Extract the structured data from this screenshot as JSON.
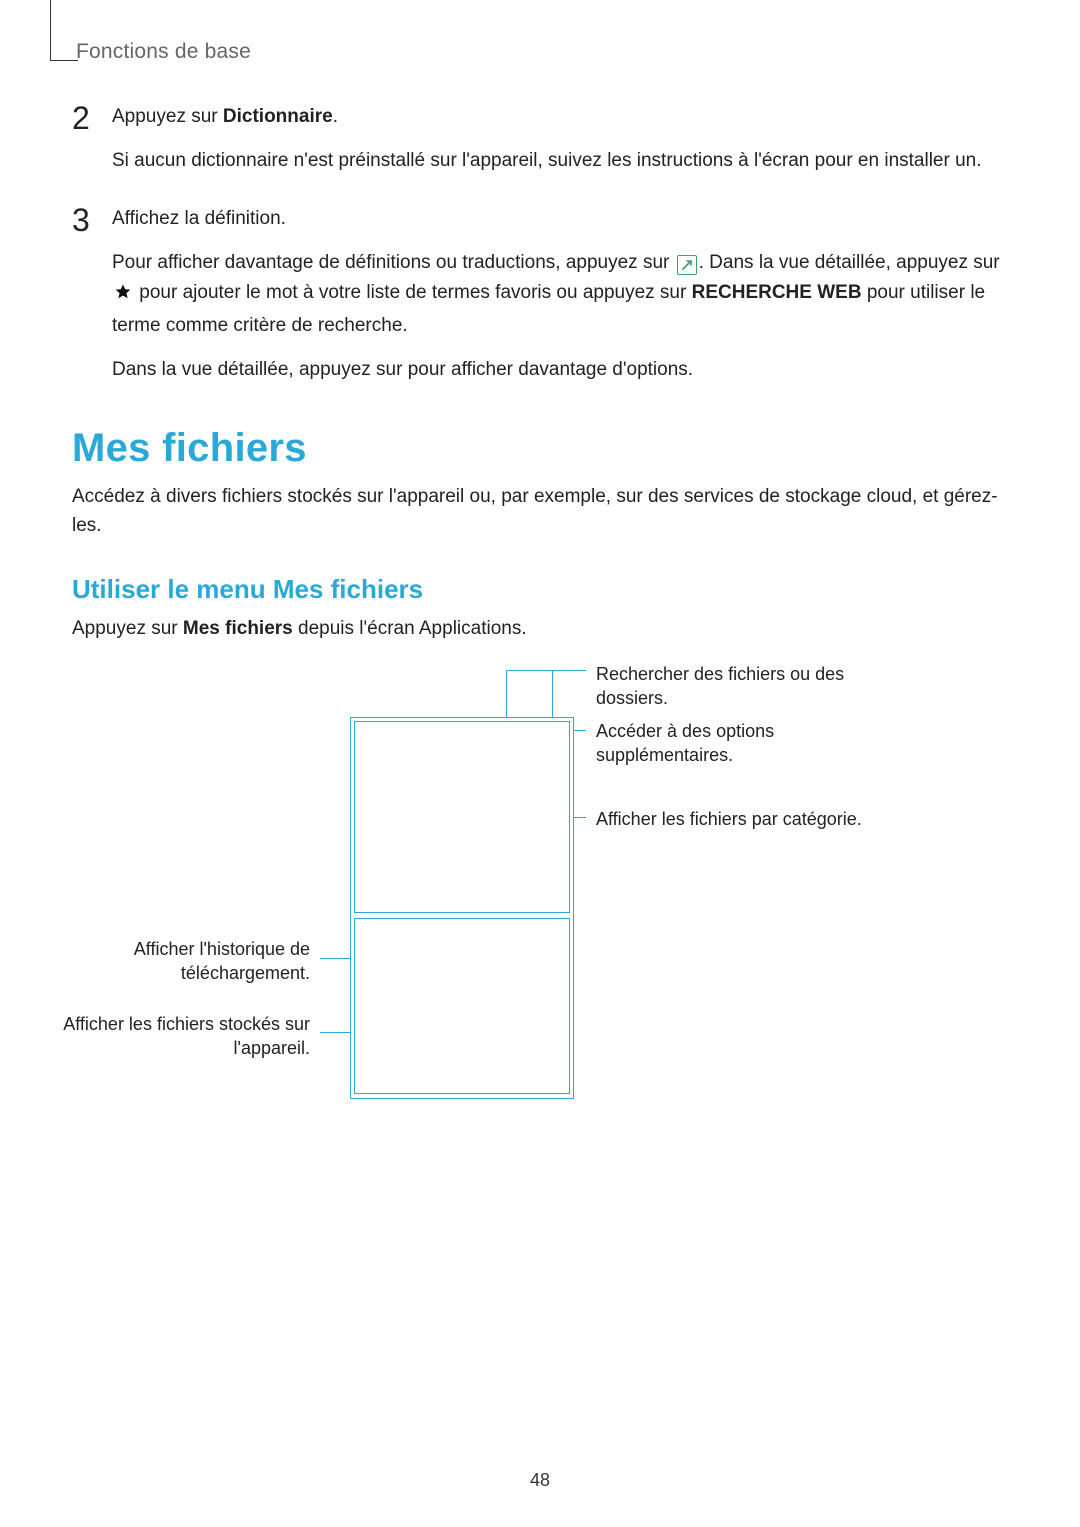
{
  "breadcrumb": "Fonctions de base",
  "steps": {
    "s2": {
      "num": "2",
      "line1_a": "Appuyez sur ",
      "line1_b": "Dictionnaire",
      "line1_c": ".",
      "line2": "Si aucun dictionnaire n'est préinstallé sur l'appareil, suivez les instructions à l'écran pour en installer un."
    },
    "s3": {
      "num": "3",
      "line1": "Affichez la définition.",
      "line2_a": "Pour afficher davantage de définitions ou traductions, appuyez sur ",
      "line2_b": ". Dans la vue détaillée, appuyez sur ",
      "line2_c": " pour ajouter le mot à votre liste de termes favoris ou appuyez sur ",
      "line2_d": "RECHERCHE WEB",
      "line2_e": " pour utiliser le terme comme critère de recherche.",
      "line3": "Dans la vue détaillée, appuyez sur   pour afficher davantage d'options."
    }
  },
  "h1": "Mes fichiers",
  "lead": "Accédez à divers fichiers stockés sur l'appareil ou, par exemple, sur des services de stockage cloud, et gérez-les.",
  "h2": "Utiliser le menu Mes fichiers",
  "sub_a": "Appuyez sur ",
  "sub_b": "Mes fichiers",
  "sub_c": " depuis l'écran Applications.",
  "callouts": {
    "r1": "Rechercher des fichiers ou des dossiers.",
    "r2": "Accéder à des options supplémentaires.",
    "r3": "Afficher les fichiers par catégorie.",
    "l1": "Afficher l'historique de téléchargement.",
    "l2": "Afficher les fichiers stockés sur l'appareil."
  },
  "page_number": "48"
}
